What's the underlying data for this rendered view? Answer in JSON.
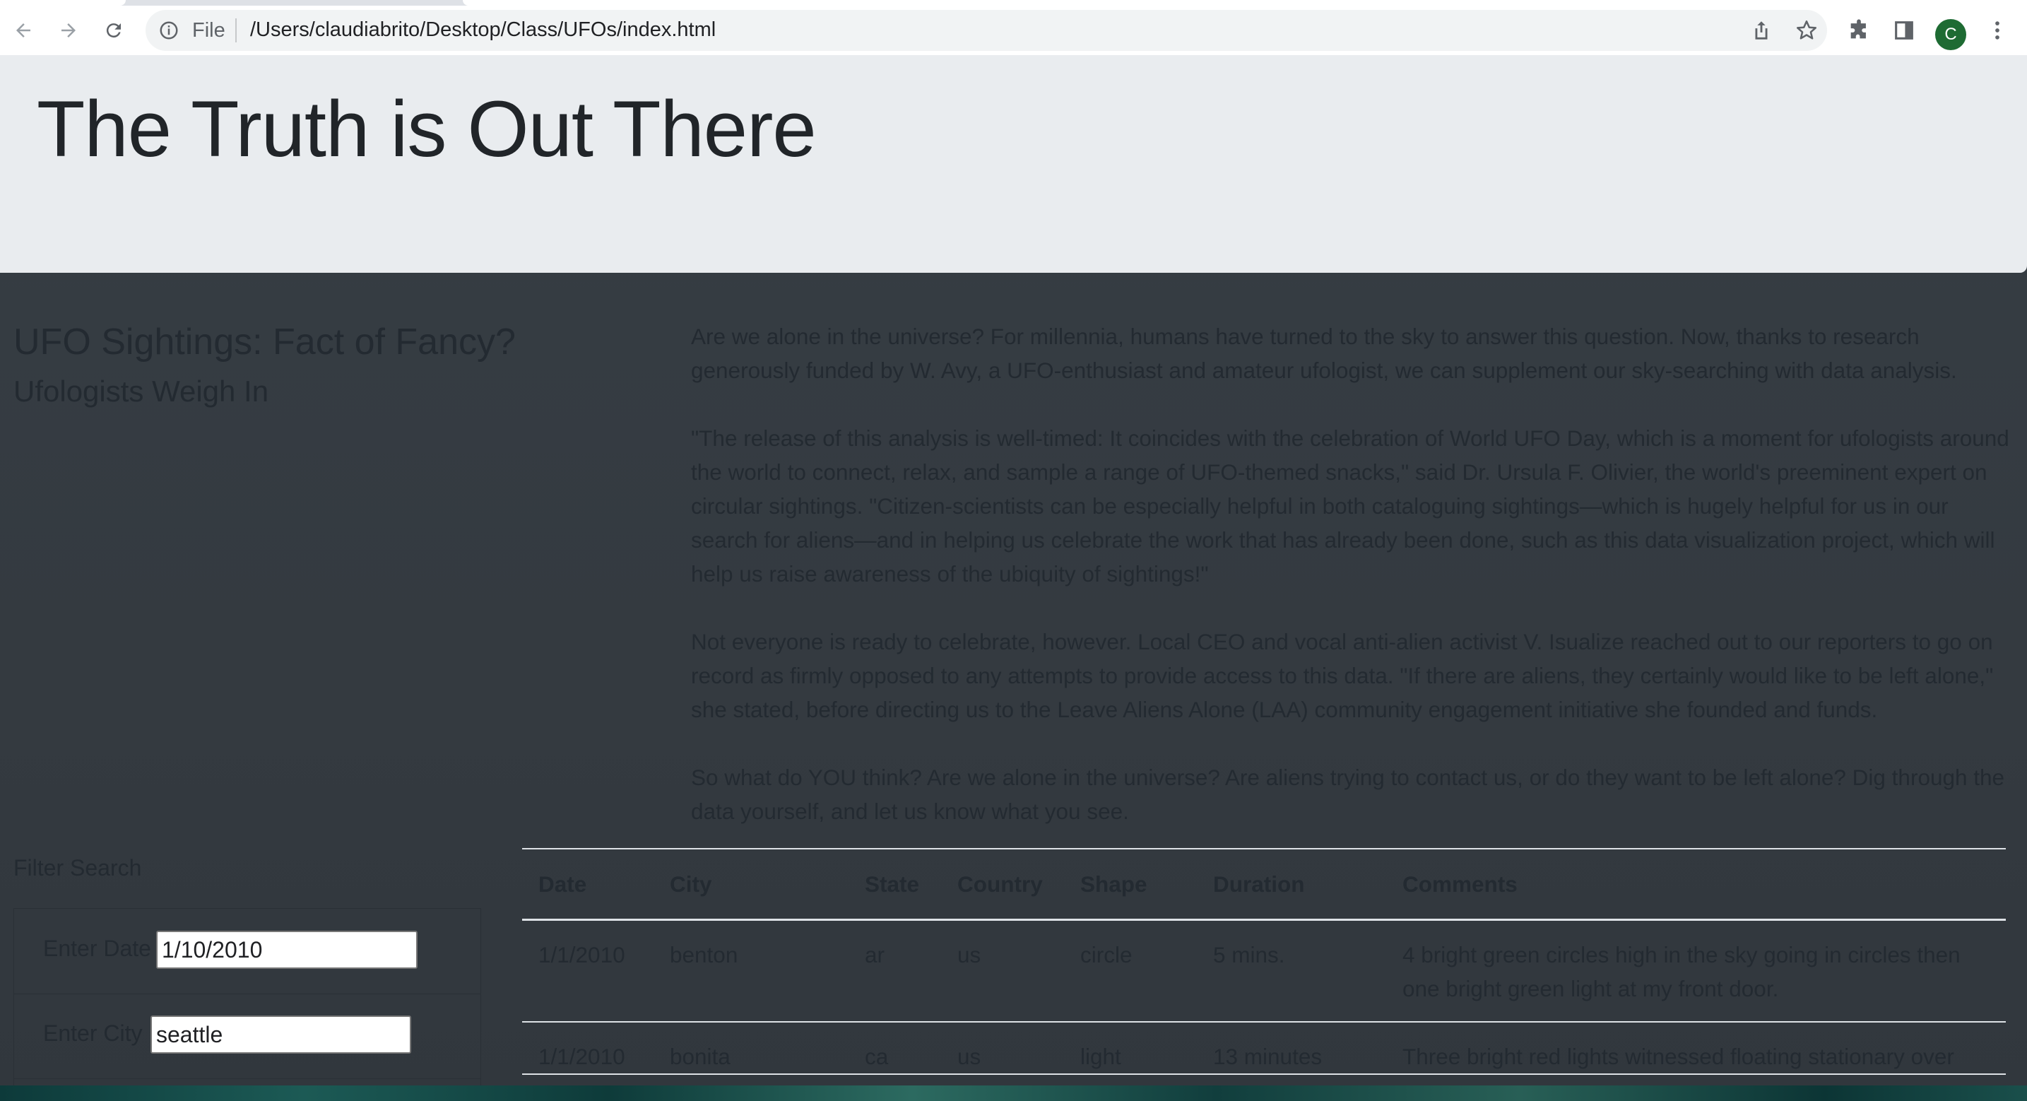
{
  "browser": {
    "scheme_label": "File",
    "url": "/Users/claudiabrito/Desktop/Class/UFOs/index.html",
    "profile_initial": "C"
  },
  "page": {
    "jumbotron_title": "The Truth is Out There",
    "article_title": "UFO Sightings: Fact of Fancy?",
    "article_subtitle": "Ufologists Weigh In",
    "paragraphs": [
      "Are we alone in the universe? For millennia, humans have turned to the sky to answer this question. Now, thanks to research generously funded by W. Avy, a UFO-enthusiast and amateur ufologist, we can supplement our sky-searching with data analysis.",
      "\"The release of this analysis is well-timed: It coincides with the celebration of World UFO Day, which is a moment for ufologists around the world to connect, relax, and sample a range of UFO-themed snacks,\" said Dr. Ursula F. Olivier, the world's preeminent expert on circular sightings. \"Citizen-scientists can be especially helpful in both cataloguing sightings—which is hugely helpful for us in our search for aliens—and in helping us celebrate the work that has already been done, such as this data visualization project, which will help us raise awareness of the ubiquity of sightings!\"",
      "Not everyone is ready to celebrate, however. Local CEO and vocal anti-alien activist V. Isualize reached out to our reporters to go on record as firmly opposed to any attempts to provide access to this data. \"If there are aliens, they certainly would like to be left alone,\" she stated, before directing us to the Leave Aliens Alone (LAA) community engagement initiative she founded and funds.",
      "So what do YOU think? Are we alone in the universe? Are aliens trying to contact us, or do they want to be left alone? Dig through the data yourself, and let us know what you see."
    ]
  },
  "filters": {
    "heading": "Filter Search",
    "date_label": "Enter Date",
    "date_value": "1/10/2010",
    "city_label": "Enter City",
    "city_value": "seattle"
  },
  "table": {
    "headers": [
      "Date",
      "City",
      "State",
      "Country",
      "Shape",
      "Duration",
      "Comments"
    ],
    "rows": [
      [
        "1/1/2010",
        "benton",
        "ar",
        "us",
        "circle",
        "5 mins.",
        "4 bright green circles high in the sky going in circles then one bright green light at my front door."
      ],
      [
        "1/1/2010",
        "bonita",
        "ca",
        "us",
        "light",
        "13 minutes",
        "Three bright red lights witnessed floating stationary over"
      ]
    ]
  },
  "icons": {
    "back": "back-arrow-icon",
    "forward": "forward-arrow-icon",
    "reload": "reload-icon",
    "info": "info-icon",
    "share": "share-icon",
    "bookmark": "star-icon",
    "extensions": "puzzle-icon",
    "side_panel": "side-panel-icon",
    "menu": "kebab-menu-icon"
  }
}
